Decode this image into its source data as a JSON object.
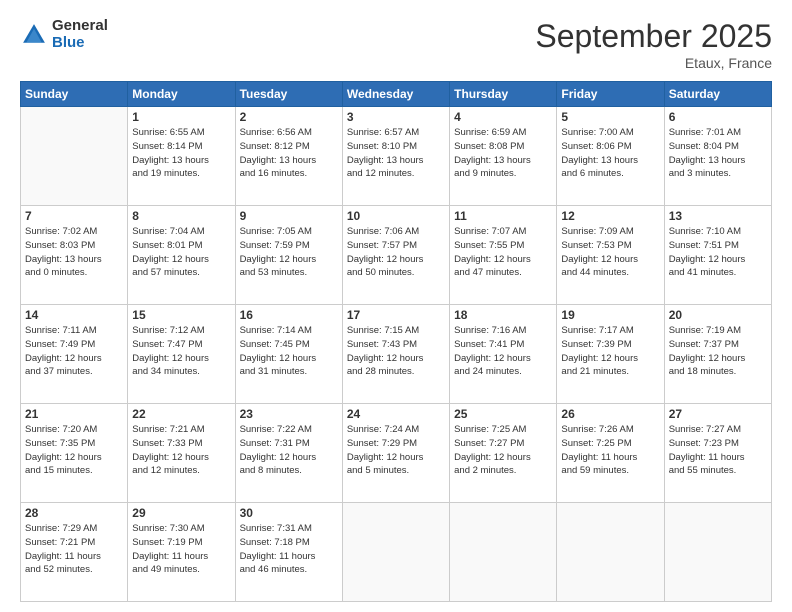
{
  "header": {
    "logo_general": "General",
    "logo_blue": "Blue",
    "title": "September 2025",
    "location": "Etaux, France"
  },
  "weekdays": [
    "Sunday",
    "Monday",
    "Tuesday",
    "Wednesday",
    "Thursday",
    "Friday",
    "Saturday"
  ],
  "weeks": [
    [
      {
        "day": "",
        "info": ""
      },
      {
        "day": "1",
        "info": "Sunrise: 6:55 AM\nSunset: 8:14 PM\nDaylight: 13 hours\nand 19 minutes."
      },
      {
        "day": "2",
        "info": "Sunrise: 6:56 AM\nSunset: 8:12 PM\nDaylight: 13 hours\nand 16 minutes."
      },
      {
        "day": "3",
        "info": "Sunrise: 6:57 AM\nSunset: 8:10 PM\nDaylight: 13 hours\nand 12 minutes."
      },
      {
        "day": "4",
        "info": "Sunrise: 6:59 AM\nSunset: 8:08 PM\nDaylight: 13 hours\nand 9 minutes."
      },
      {
        "day": "5",
        "info": "Sunrise: 7:00 AM\nSunset: 8:06 PM\nDaylight: 13 hours\nand 6 minutes."
      },
      {
        "day": "6",
        "info": "Sunrise: 7:01 AM\nSunset: 8:04 PM\nDaylight: 13 hours\nand 3 minutes."
      }
    ],
    [
      {
        "day": "7",
        "info": "Sunrise: 7:02 AM\nSunset: 8:03 PM\nDaylight: 13 hours\nand 0 minutes."
      },
      {
        "day": "8",
        "info": "Sunrise: 7:04 AM\nSunset: 8:01 PM\nDaylight: 12 hours\nand 57 minutes."
      },
      {
        "day": "9",
        "info": "Sunrise: 7:05 AM\nSunset: 7:59 PM\nDaylight: 12 hours\nand 53 minutes."
      },
      {
        "day": "10",
        "info": "Sunrise: 7:06 AM\nSunset: 7:57 PM\nDaylight: 12 hours\nand 50 minutes."
      },
      {
        "day": "11",
        "info": "Sunrise: 7:07 AM\nSunset: 7:55 PM\nDaylight: 12 hours\nand 47 minutes."
      },
      {
        "day": "12",
        "info": "Sunrise: 7:09 AM\nSunset: 7:53 PM\nDaylight: 12 hours\nand 44 minutes."
      },
      {
        "day": "13",
        "info": "Sunrise: 7:10 AM\nSunset: 7:51 PM\nDaylight: 12 hours\nand 41 minutes."
      }
    ],
    [
      {
        "day": "14",
        "info": "Sunrise: 7:11 AM\nSunset: 7:49 PM\nDaylight: 12 hours\nand 37 minutes."
      },
      {
        "day": "15",
        "info": "Sunrise: 7:12 AM\nSunset: 7:47 PM\nDaylight: 12 hours\nand 34 minutes."
      },
      {
        "day": "16",
        "info": "Sunrise: 7:14 AM\nSunset: 7:45 PM\nDaylight: 12 hours\nand 31 minutes."
      },
      {
        "day": "17",
        "info": "Sunrise: 7:15 AM\nSunset: 7:43 PM\nDaylight: 12 hours\nand 28 minutes."
      },
      {
        "day": "18",
        "info": "Sunrise: 7:16 AM\nSunset: 7:41 PM\nDaylight: 12 hours\nand 24 minutes."
      },
      {
        "day": "19",
        "info": "Sunrise: 7:17 AM\nSunset: 7:39 PM\nDaylight: 12 hours\nand 21 minutes."
      },
      {
        "day": "20",
        "info": "Sunrise: 7:19 AM\nSunset: 7:37 PM\nDaylight: 12 hours\nand 18 minutes."
      }
    ],
    [
      {
        "day": "21",
        "info": "Sunrise: 7:20 AM\nSunset: 7:35 PM\nDaylight: 12 hours\nand 15 minutes."
      },
      {
        "day": "22",
        "info": "Sunrise: 7:21 AM\nSunset: 7:33 PM\nDaylight: 12 hours\nand 12 minutes."
      },
      {
        "day": "23",
        "info": "Sunrise: 7:22 AM\nSunset: 7:31 PM\nDaylight: 12 hours\nand 8 minutes."
      },
      {
        "day": "24",
        "info": "Sunrise: 7:24 AM\nSunset: 7:29 PM\nDaylight: 12 hours\nand 5 minutes."
      },
      {
        "day": "25",
        "info": "Sunrise: 7:25 AM\nSunset: 7:27 PM\nDaylight: 12 hours\nand 2 minutes."
      },
      {
        "day": "26",
        "info": "Sunrise: 7:26 AM\nSunset: 7:25 PM\nDaylight: 11 hours\nand 59 minutes."
      },
      {
        "day": "27",
        "info": "Sunrise: 7:27 AM\nSunset: 7:23 PM\nDaylight: 11 hours\nand 55 minutes."
      }
    ],
    [
      {
        "day": "28",
        "info": "Sunrise: 7:29 AM\nSunset: 7:21 PM\nDaylight: 11 hours\nand 52 minutes."
      },
      {
        "day": "29",
        "info": "Sunrise: 7:30 AM\nSunset: 7:19 PM\nDaylight: 11 hours\nand 49 minutes."
      },
      {
        "day": "30",
        "info": "Sunrise: 7:31 AM\nSunset: 7:18 PM\nDaylight: 11 hours\nand 46 minutes."
      },
      {
        "day": "",
        "info": ""
      },
      {
        "day": "",
        "info": ""
      },
      {
        "day": "",
        "info": ""
      },
      {
        "day": "",
        "info": ""
      }
    ]
  ]
}
